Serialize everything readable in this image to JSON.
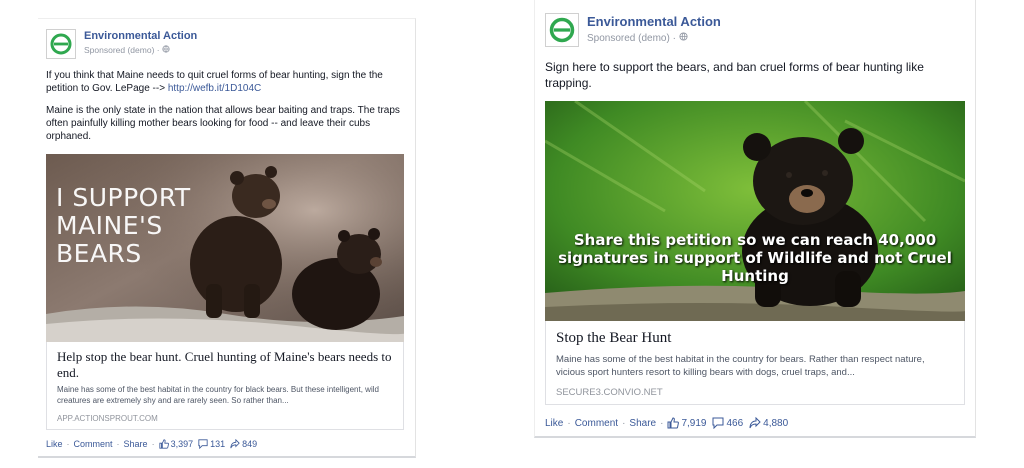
{
  "left": {
    "page_name": "Environmental Action",
    "sponsored": "Sponsored (demo) ·",
    "text_line1": "If you think that Maine needs to quit cruel forms of bear hunting, sign the the petition to Gov. LePage -->",
    "link": "http://wefb.it/1D104C",
    "text_line2": "Maine is the only state in the nation that allows bear baiting and traps. The traps often painfully killing mother bears looking for food -- and leave their cubs orphaned.",
    "image_overlay": [
      "I SUPPORT",
      "MAINE'S",
      "BEARS"
    ],
    "link_title": "Help stop the bear hunt. Cruel hunting of Maine's bears needs to end.",
    "link_desc": "Maine has some of the best habitat in the country for black bears. But these intelligent, wild creatures are extremely shy and are rarely seen. So rather than...",
    "link_domain": "APP.ACTIONSPROUT.COM",
    "like": "Like",
    "comment": "Comment",
    "share": "Share",
    "likes": "3,397",
    "comments": "131",
    "shares": "849"
  },
  "right": {
    "page_name": "Environmental Action",
    "sponsored": "Sponsored (demo) ·",
    "text": "Sign here to support the bears, and ban cruel forms of bear hunting like trapping.",
    "image_overlay": [
      "Share this petition so we can reach 40,000",
      "signatures in support of Wildlife and not Cruel",
      "Hunting"
    ],
    "link_title": "Stop the Bear Hunt",
    "link_desc": "Maine has some of the best habitat in the country for bears. Rather than respect nature, vicious sport hunters resort to killing bears with dogs, cruel traps, and...",
    "link_domain": "SECURE3.CONVIO.NET",
    "like": "Like",
    "comment": "Comment",
    "share": "Share",
    "likes": "7,919",
    "comments": "466",
    "shares": "4,880"
  },
  "colors": {
    "link": "#3b5998",
    "meta": "#9197a3",
    "logo_green": "#2fa84f"
  },
  "icons": [
    "ea-logo-icon",
    "globe-icon",
    "thumbs-up-icon",
    "comment-icon",
    "share-icon"
  ]
}
